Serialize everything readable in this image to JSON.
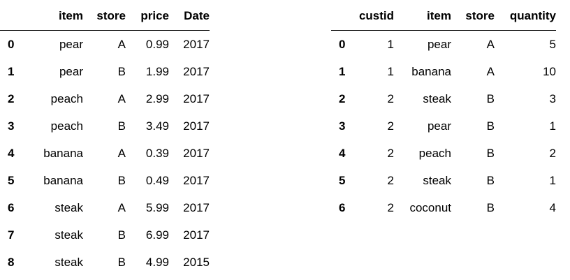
{
  "left_table": {
    "columns": [
      "",
      "item",
      "store",
      "price",
      "Date"
    ],
    "rows": [
      {
        "index": "0",
        "item": "pear",
        "store": "A",
        "price": "0.99",
        "date": "2017"
      },
      {
        "index": "1",
        "item": "pear",
        "store": "B",
        "price": "1.99",
        "date": "2017"
      },
      {
        "index": "2",
        "item": "peach",
        "store": "A",
        "price": "2.99",
        "date": "2017"
      },
      {
        "index": "3",
        "item": "peach",
        "store": "B",
        "price": "3.49",
        "date": "2017"
      },
      {
        "index": "4",
        "item": "banana",
        "store": "A",
        "price": "0.39",
        "date": "2017"
      },
      {
        "index": "5",
        "item": "banana",
        "store": "B",
        "price": "0.49",
        "date": "2017"
      },
      {
        "index": "6",
        "item": "steak",
        "store": "A",
        "price": "5.99",
        "date": "2017"
      },
      {
        "index": "7",
        "item": "steak",
        "store": "B",
        "price": "6.99",
        "date": "2017"
      },
      {
        "index": "8",
        "item": "steak",
        "store": "B",
        "price": "4.99",
        "date": "2015"
      }
    ]
  },
  "right_table": {
    "columns": [
      "",
      "custid",
      "item",
      "store",
      "quantity"
    ],
    "rows": [
      {
        "index": "0",
        "custid": "1",
        "item": "pear",
        "store": "A",
        "quantity": "5"
      },
      {
        "index": "1",
        "custid": "1",
        "item": "banana",
        "store": "A",
        "quantity": "10"
      },
      {
        "index": "2",
        "custid": "2",
        "item": "steak",
        "store": "B",
        "quantity": "3"
      },
      {
        "index": "3",
        "custid": "2",
        "item": "pear",
        "store": "B",
        "quantity": "1"
      },
      {
        "index": "4",
        "custid": "2",
        "item": "peach",
        "store": "B",
        "quantity": "2"
      },
      {
        "index": "5",
        "custid": "2",
        "item": "steak",
        "store": "B",
        "quantity": "1"
      },
      {
        "index": "6",
        "custid": "2",
        "item": "coconut",
        "store": "B",
        "quantity": "4"
      }
    ]
  }
}
